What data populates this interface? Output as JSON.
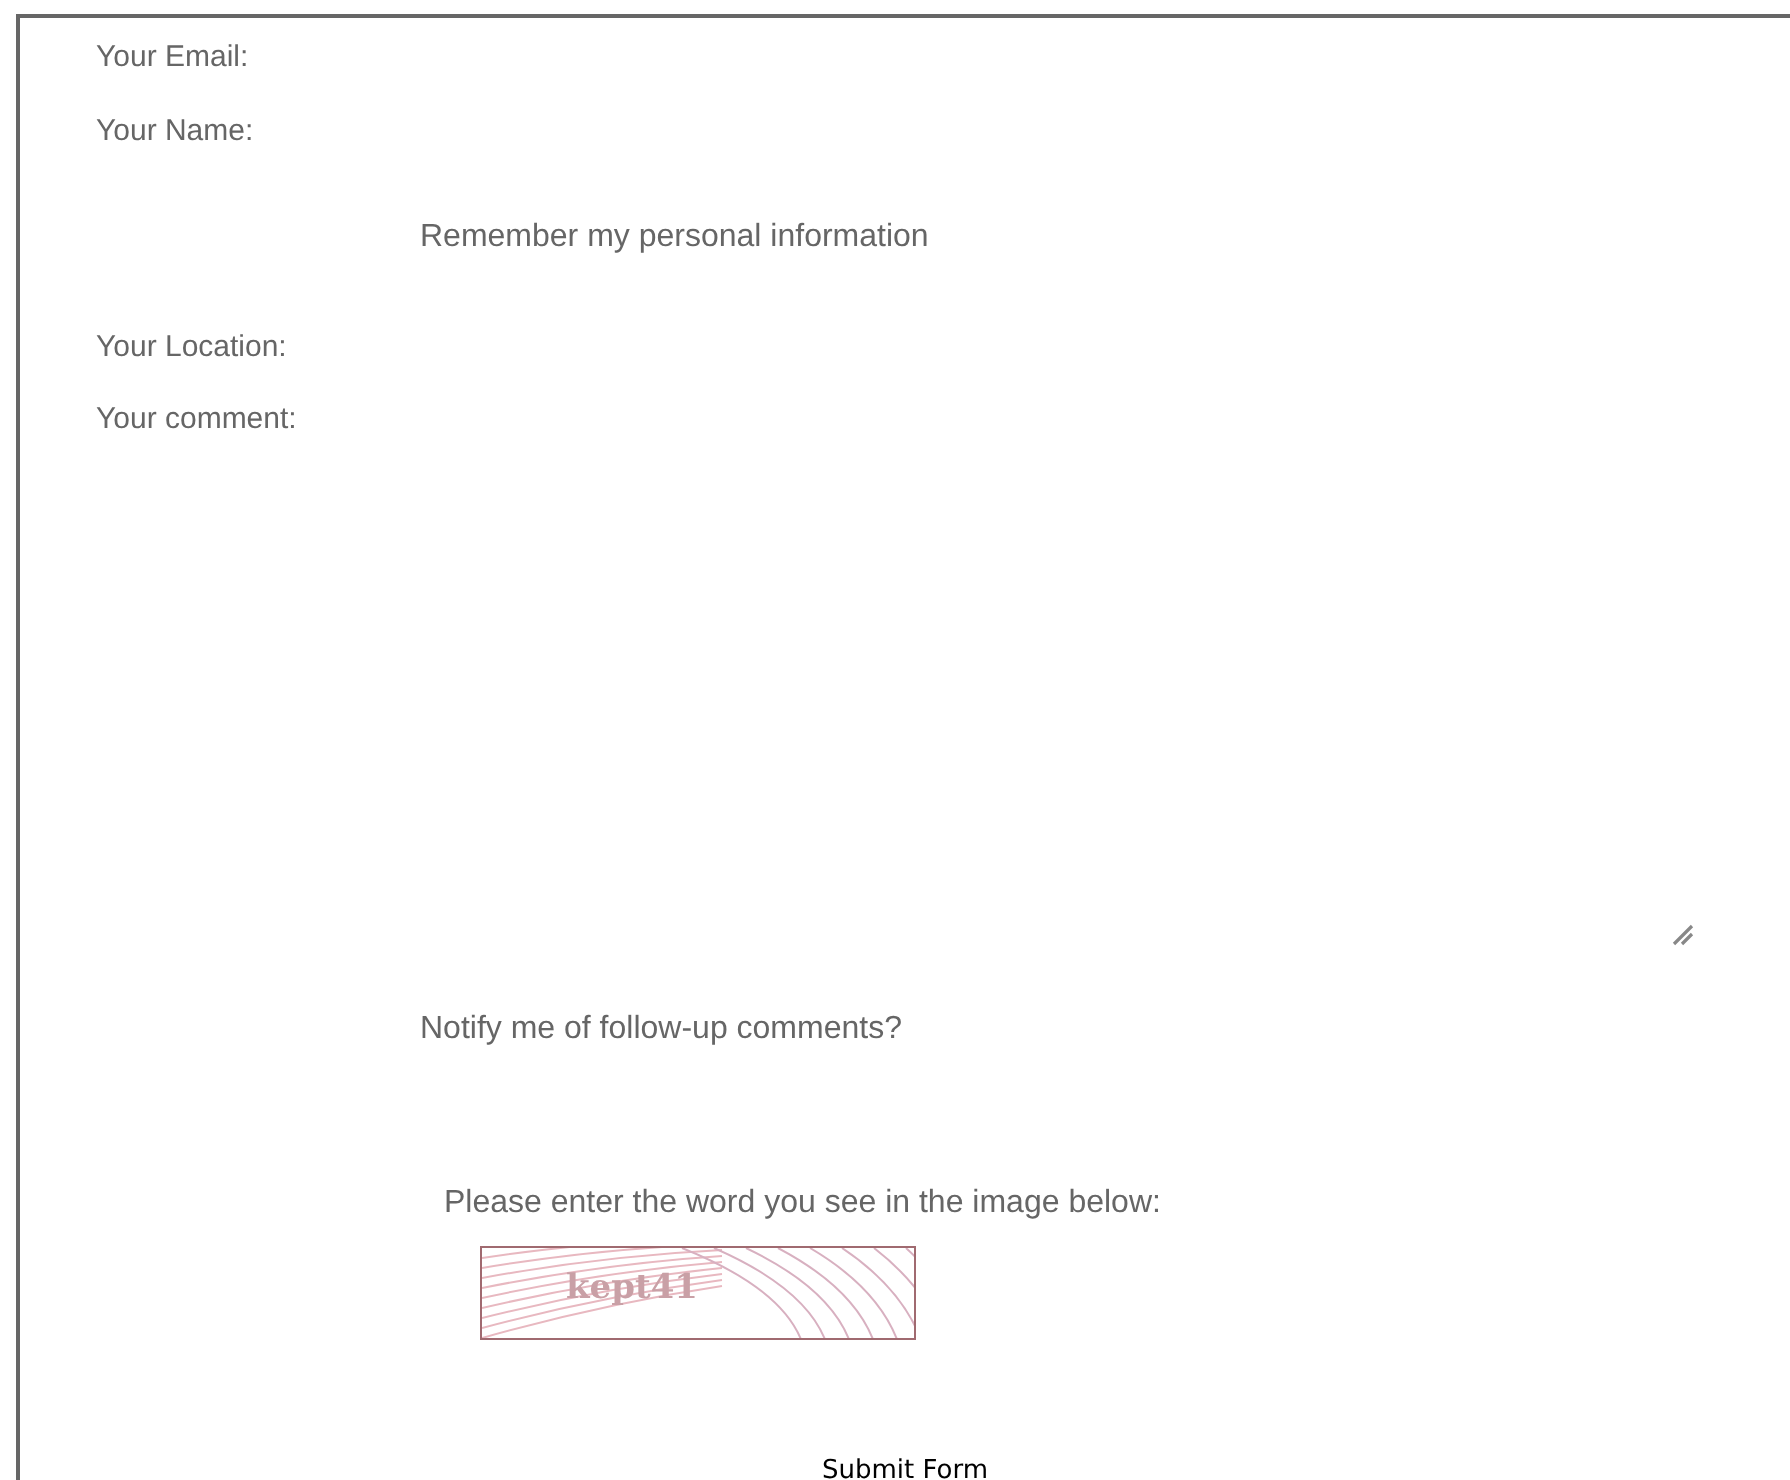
{
  "form": {
    "fields": [
      {
        "kind": "label",
        "label": "Your Email:"
      },
      {
        "kind": "label",
        "label": "Your Name:"
      },
      {
        "kind": "option",
        "label": "Remember my personal information"
      },
      {
        "kind": "label",
        "label": "Your Location:"
      },
      {
        "kind": "label",
        "label": "Your comment:"
      },
      {
        "kind": "textarea"
      },
      {
        "kind": "option",
        "label": "Notify me of follow-up comments?"
      }
    ],
    "captcha": {
      "prompt": "Please enter the word you see in the image below:",
      "word": "kept41"
    },
    "submit": "Submit Form"
  }
}
